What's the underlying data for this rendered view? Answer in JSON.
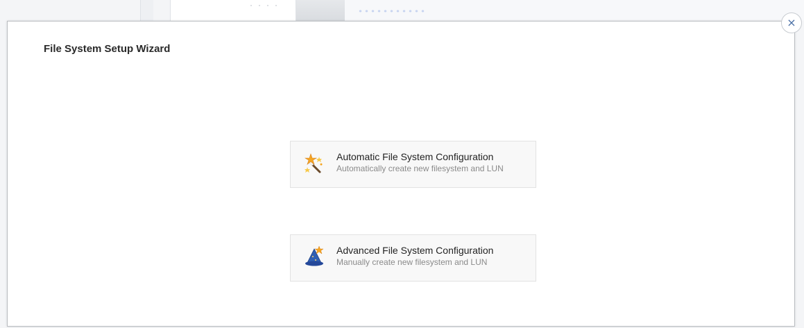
{
  "dialog": {
    "title": "File System Setup Wizard",
    "close_label": "×"
  },
  "options": [
    {
      "title": "Automatic File System Configuration",
      "description": "Automatically create new filesystem and LUN",
      "icon": "magic-wand-icon"
    },
    {
      "title": "Advanced File System Configuration",
      "description": "Manually create new filesystem and LUN",
      "icon": "wizard-hat-icon"
    }
  ],
  "colors": {
    "accent": "#4a6fa5",
    "option_bg": "#f8f8f8",
    "option_border": "#e2e2e2",
    "description_text": "#8a8a8a"
  }
}
